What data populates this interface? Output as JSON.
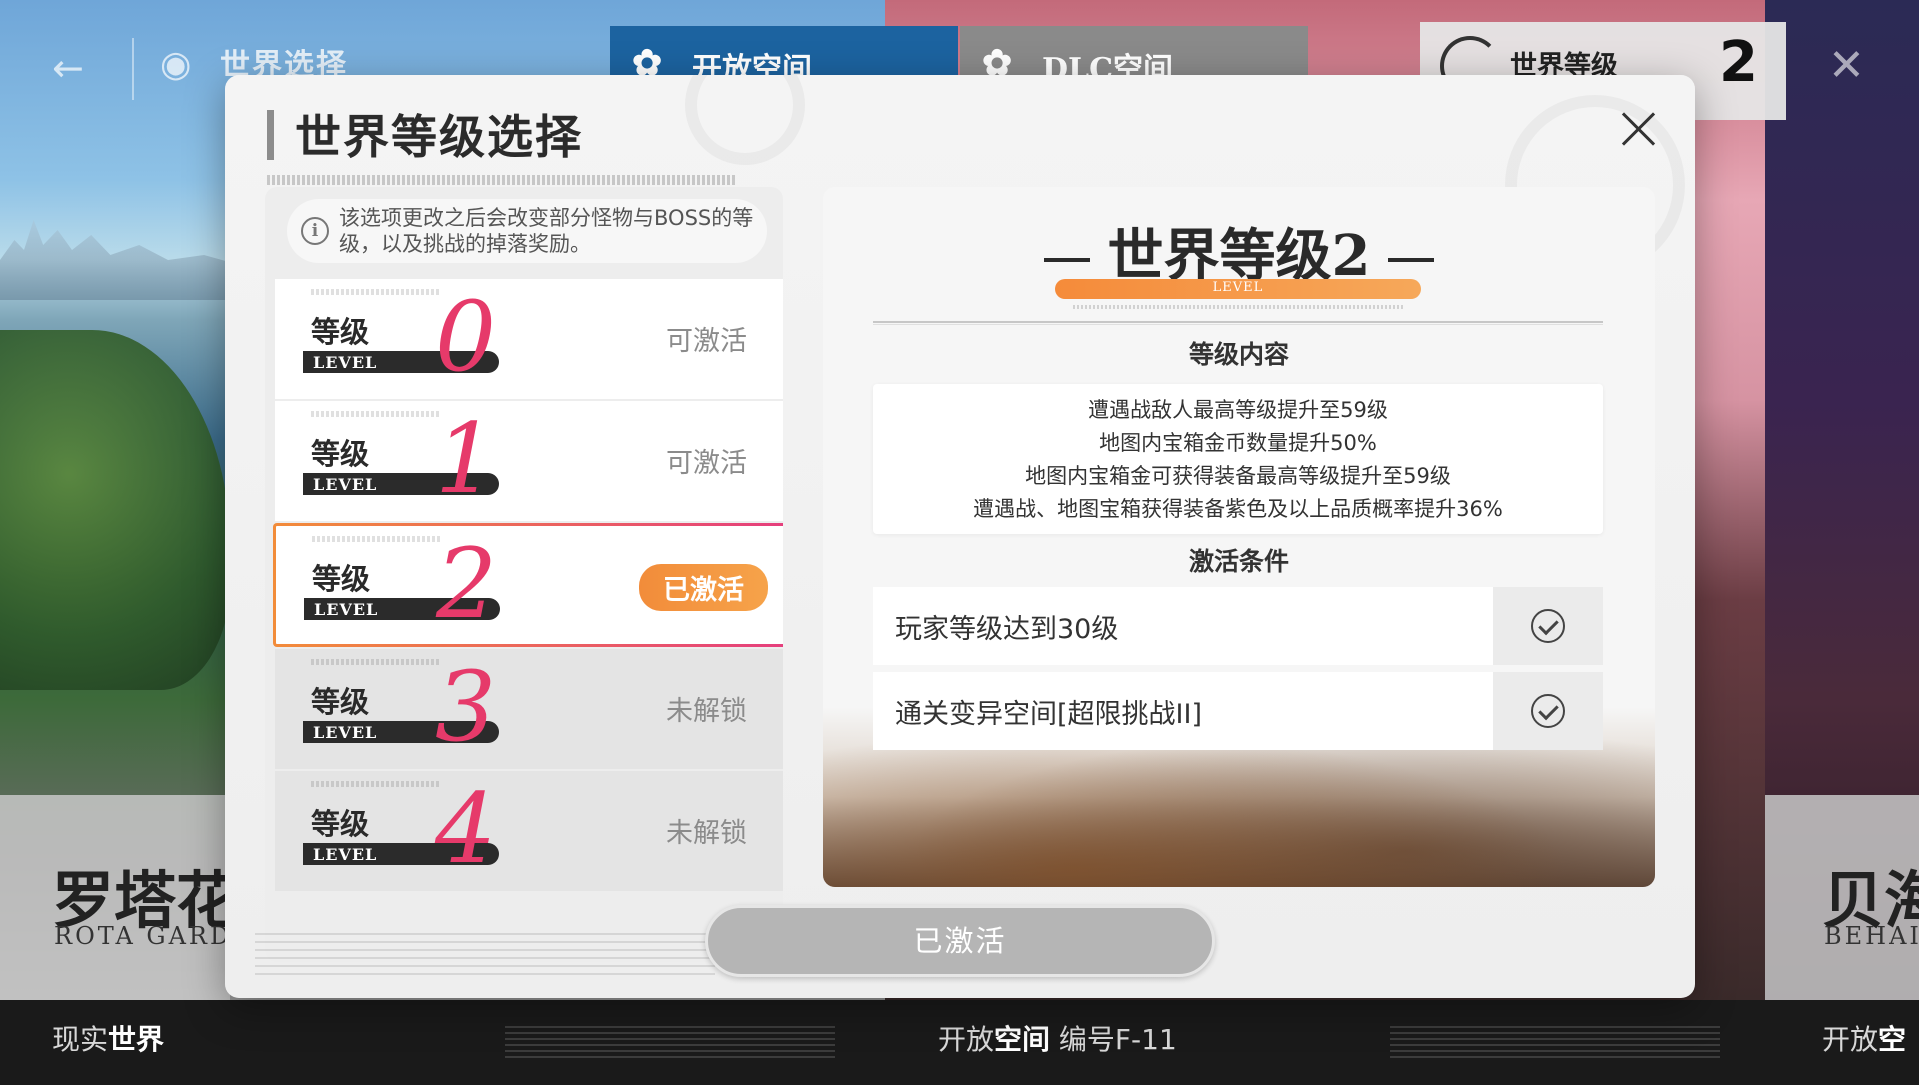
{
  "background": {
    "nav_title": "世界选择",
    "tab_open_space": "开放空间",
    "tab_dlc_space": "DLC空间",
    "world_level_label": "世界等级",
    "world_level_value": "2",
    "left_card_title": "罗塔花",
    "left_card_subtitle": "ROTA GARDE",
    "right_card_title": "贝海",
    "right_card_subtitle": "BEHAI",
    "bottom_left_prefix": "现实",
    "bottom_left_bold": "世界",
    "bottom_mid_prefix": "开放",
    "bottom_mid_bold": "空间",
    "bottom_mid_suffix": " 编号F-11",
    "bottom_right_prefix": "开放",
    "bottom_right_bold": "空"
  },
  "modal": {
    "title": "世界等级选择",
    "notice": "该选项更改之后会改变部分怪物与BOSS的等级，以及挑战的掉落奖励。",
    "levels": [
      {
        "label": "等级",
        "label_en": "LEVEL",
        "number": "0",
        "status": "可激活"
      },
      {
        "label": "等级",
        "label_en": "LEVEL",
        "number": "1",
        "status": "可激活"
      },
      {
        "label": "等级",
        "label_en": "LEVEL",
        "number": "2",
        "status": "已激活"
      },
      {
        "label": "等级",
        "label_en": "LEVEL",
        "number": "3",
        "status": "未解锁"
      },
      {
        "label": "等级",
        "label_en": "LEVEL",
        "number": "4",
        "status": "未解锁"
      }
    ],
    "detail": {
      "title": "世界等级2",
      "level_tag": "LEVEL",
      "effects_heading": "等级内容",
      "effects": [
        "遭遇战敌人最高等级提升至59级",
        "地图内宝箱金币数量提升50%",
        "地图内宝箱金可获得装备最高等级提升至59级",
        "遭遇战、地图宝箱获得装备紫色及以上品质概率提升36%"
      ],
      "conditions_heading": "激活条件",
      "conditions": [
        {
          "text": "玩家等级达到30级",
          "met": true
        },
        {
          "text": "通关变异空间[超限挑战II]",
          "met": true
        }
      ]
    },
    "action_button": "已激活"
  },
  "colors": {
    "accent_orange": "#f28c3a",
    "accent_pink": "#e63a6a",
    "open_space_tab": "#1c63a0"
  }
}
